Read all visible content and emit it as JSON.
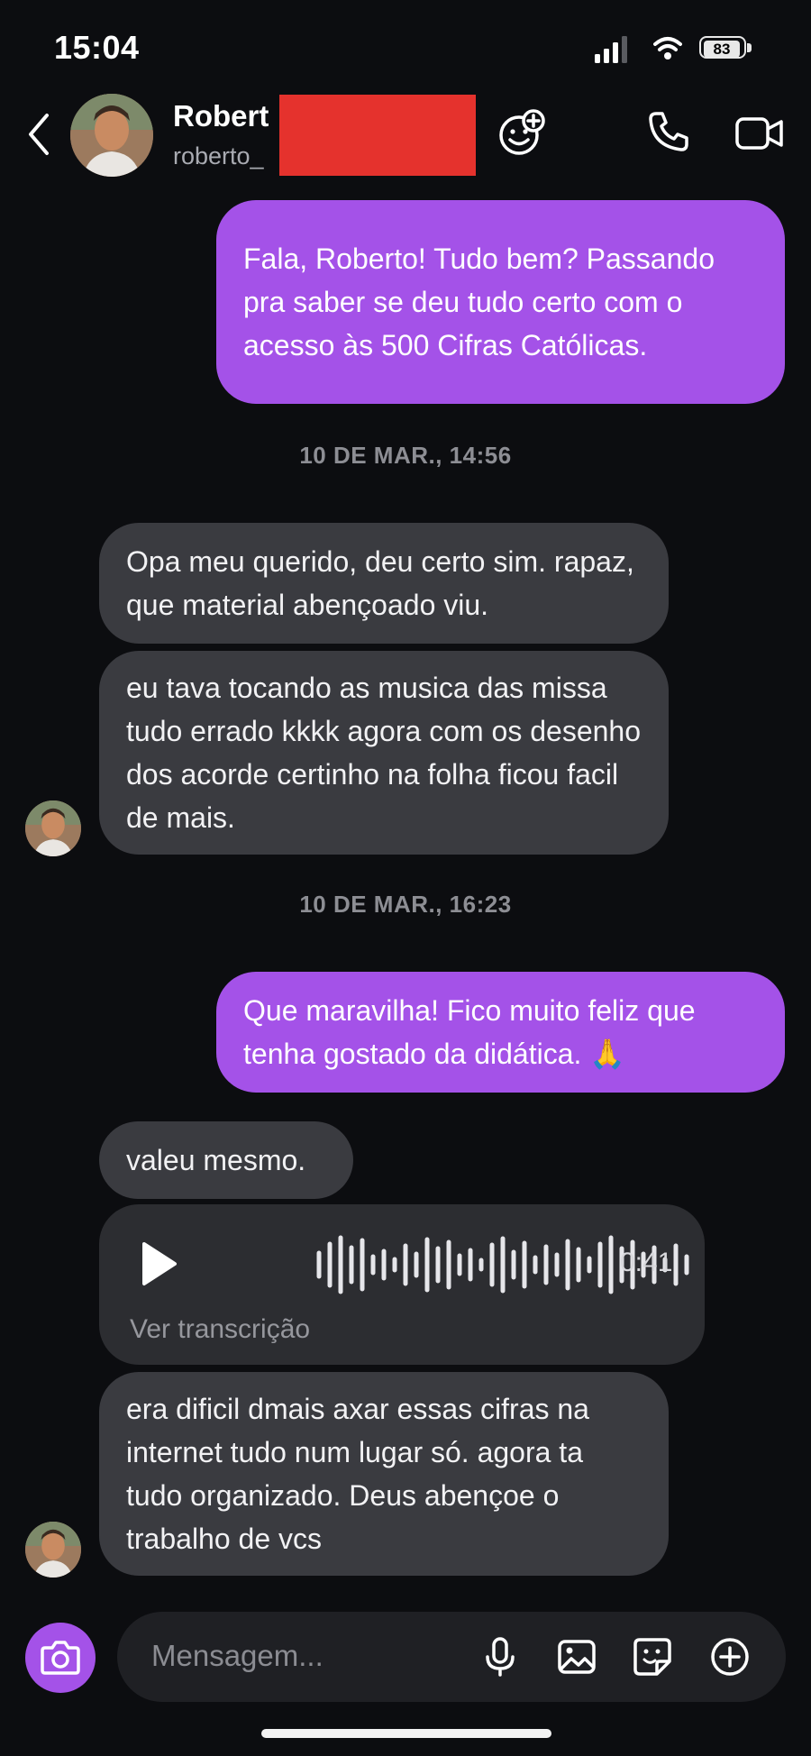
{
  "status_bar": {
    "time": "15:04",
    "battery": "83"
  },
  "header": {
    "name": "Robert",
    "username": "roberto_",
    "icons": {
      "back": "chevron-left-icon",
      "effects": "smiley-plus-icon",
      "call": "phone-icon",
      "video": "video-camera-icon"
    }
  },
  "messages": {
    "m1": "Fala, Roberto! Tudo bem? Passando pra saber se deu tudo certo com o acesso às 500 Cifras Católicas.",
    "ts1": "10 DE MAR., 14:56",
    "m2": "Opa meu querido, deu certo sim. rapaz, que material abençoado viu.",
    "m3": "eu tava tocando as musica das missa tudo errado kkkk agora com os desenho dos acorde certinho na folha ficou facil de mais.",
    "ts2": "10 DE MAR., 16:23",
    "m4": "Que maravilha! Fico muito feliz que tenha gostado da didática. 🙏",
    "m5": "valeu mesmo.",
    "voice": {
      "duration": "0:41",
      "transcription_link": "Ver transcrição"
    },
    "m6": "era dificil dmais axar essas cifras na internet tudo num lugar só. agora ta tudo organizado. Deus abençoe o trabalho de vcs"
  },
  "composer": {
    "placeholder": "Mensagem...",
    "icons": [
      "camera-icon",
      "microphone-icon",
      "image-icon",
      "sticker-icon",
      "plus-circle-icon"
    ]
  },
  "colors": {
    "outgoing": "#a452e8",
    "incoming": "#3a3b40",
    "background": "#0c0d10",
    "redaction": "#e5322d"
  }
}
